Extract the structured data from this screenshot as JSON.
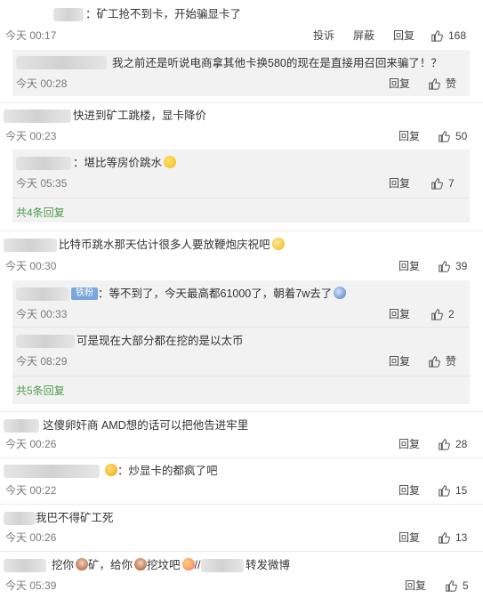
{
  "actions": {
    "report": "投诉",
    "block": "屏蔽",
    "reply": "回复",
    "like_zero": "赞"
  },
  "c1": {
    "text": "：矿工抢不到卡，开始骗显卡了",
    "time": "今天 00:17",
    "likes": "168"
  },
  "c1r1": {
    "text": "我之前还是听说电商拿其他卡换580的现在是直接用召回来骗了！？",
    "time": "今天 00:28"
  },
  "c2": {
    "text": "快进到矿工跳楼，显卡降价",
    "time": "今天 00:23",
    "likes": "50"
  },
  "c2r1": {
    "text": "：堪比等房价跳水",
    "time": "今天 05:35",
    "likes": "7"
  },
  "c2_more": "共4条回复",
  "c3": {
    "text": "比特币跳水那天估计很多人要放鞭炮庆祝吧",
    "time": "今天 00:30",
    "likes": "39"
  },
  "c3r1": {
    "badge": "铁粉",
    "text": "：等不到了，今天最高都61000了，朝着7w去了",
    "time": "今天 00:33",
    "likes": "2"
  },
  "c3r2": {
    "text": "可是现在大部分都在挖的是以太币",
    "time": "今天 08:29"
  },
  "c3_more": "共5条回复",
  "c4": {
    "text": "这傻卵奸商 AMD想的话可以把他告进牢里",
    "time": "今天 00:26",
    "likes": "28"
  },
  "c5": {
    "text": "：炒显卡的都疯了吧",
    "time": "今天 00:22",
    "likes": "15"
  },
  "c6": {
    "text": "我巴不得矿工死",
    "time": "今天 00:26",
    "likes": "13"
  },
  "c7": {
    "t1": "挖你",
    "t2": "矿，给你",
    "t3": "挖坟吧",
    "t4": "//",
    "t5": "转发微博",
    "time": "今天 05:39",
    "likes": "5"
  },
  "icons": [
    "thumb-up-icon",
    "emoji-grin-icon",
    "emoji-blush-icon",
    "emoji-cold-face-icon",
    "emoji-heart-eyes-icon",
    "emoji-woman-icon",
    "emoji-hug-icon"
  ],
  "colors": {
    "link_green": "#4e9c4e",
    "badge_blue": "#7aa6de",
    "reply_bg": "#f2f2f2"
  }
}
